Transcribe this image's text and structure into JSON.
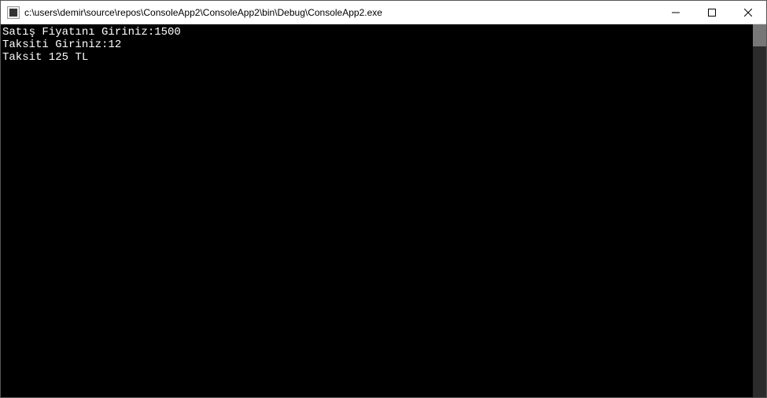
{
  "titlebar": {
    "title": "c:\\users\\demir\\source\\repos\\ConsoleApp2\\ConsoleApp2\\bin\\Debug\\ConsoleApp2.exe"
  },
  "console": {
    "lines": [
      "Satış Fiyatını Giriniz:1500",
      "Taksiti Giriniz:12",
      "Taksit 125 TL"
    ]
  }
}
